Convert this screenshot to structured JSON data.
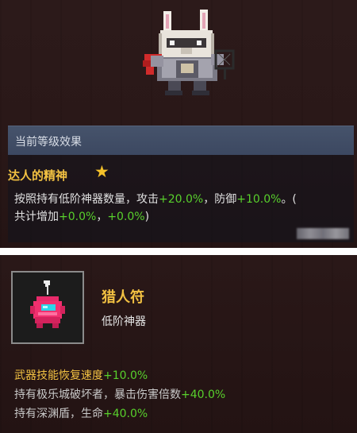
{
  "talent_panel": {
    "header": "当前等级效果",
    "talent_name": "达人的精神",
    "description": {
      "part1": "按照持有低阶神器数量，攻击",
      "attack_bonus": "+20.0%",
      "part2": "，防御",
      "defense_bonus": "+10.0%",
      "part3": "。(",
      "line2_part1": "共计增加",
      "total_attack": "+0.0%",
      "line2_sep": "，",
      "total_defense": "+0.0%",
      "line2_end": ")"
    }
  },
  "item_panel": {
    "name": "猎人符",
    "type": "低阶神器",
    "effects": [
      {
        "text": "武器技能恢复速度",
        "value": "+10.0%"
      },
      {
        "text": "持有极乐城破坏者，暴击伤害倍数",
        "value": "+40.0%"
      },
      {
        "text": "持有深渊盾，生命",
        "value": "+40.0%"
      }
    ]
  },
  "colors": {
    "gold": "#f2c142",
    "green": "#58d02c",
    "header_bg": "#46536b"
  },
  "icons": [
    "rabbit-knight-portrait-icon",
    "star-icon",
    "pink-creature-charm-icon"
  ]
}
